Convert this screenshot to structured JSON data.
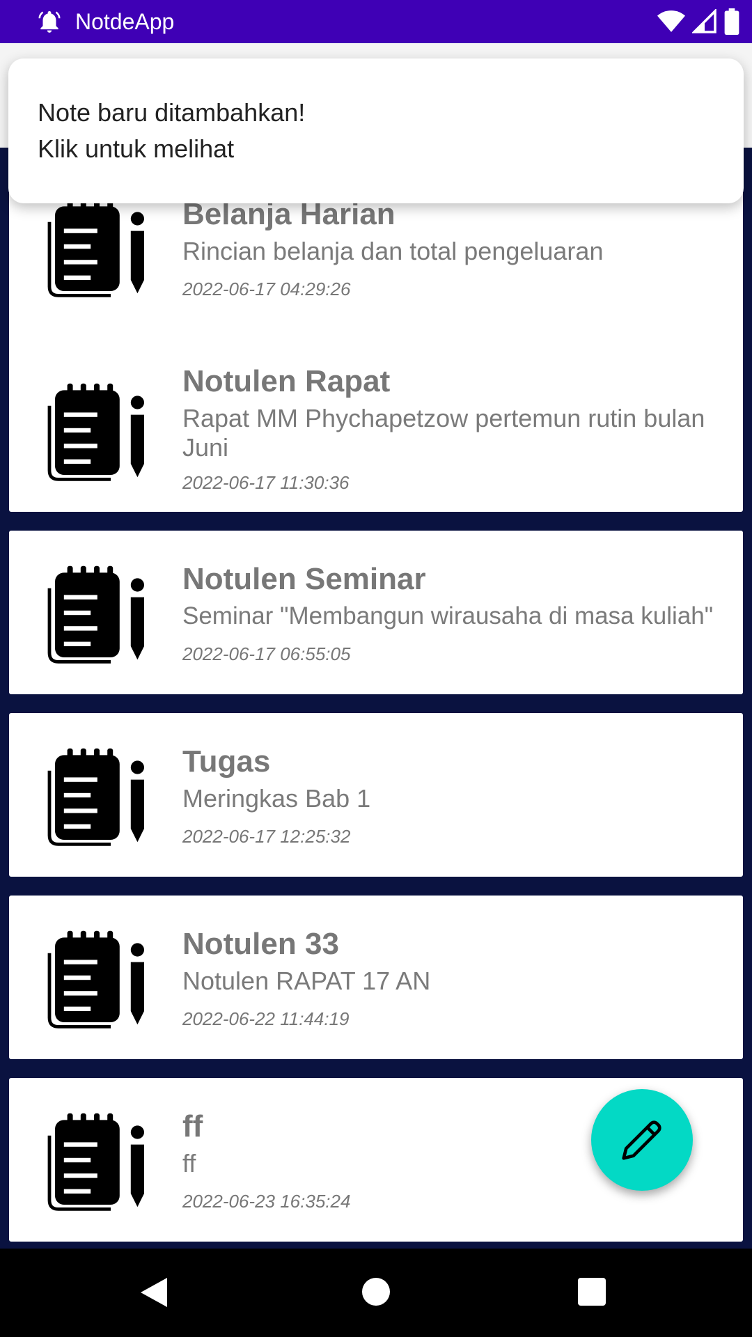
{
  "status_bar": {
    "app_name": "NotdeApp",
    "icons": [
      "notification-bell-icon",
      "wifi-icon",
      "cell-signal-icon",
      "battery-icon"
    ]
  },
  "toast": {
    "line1": "Note baru ditambahkan!",
    "line2": "Klik untuk melihat"
  },
  "notes": [
    {
      "title": "Belanja Harian",
      "desc": "Rincian belanja dan total pengeluaran",
      "date": "2022-06-17 04:29:26"
    },
    {
      "title": "Notulen Rapat",
      "desc": "Rapat MM Phychapetzow pertemun rutin bulan Juni",
      "date": "2022-06-17 11:30:36"
    },
    {
      "title": "Notulen Seminar",
      "desc": "Seminar \"Membangun wirausaha di masa kuliah\"",
      "date": "2022-06-17 06:55:05"
    },
    {
      "title": "Tugas",
      "desc": "Meringkas Bab 1",
      "date": "2022-06-17 12:25:32"
    },
    {
      "title": "Notulen 33",
      "desc": "Notulen RAPAT 17 AN",
      "date": "2022-06-22 11:44:19"
    },
    {
      "title": "ff",
      "desc": "ff",
      "date": "2022-06-23 16:35:24"
    }
  ],
  "fab": {
    "icon": "pencil-icon",
    "color": "#03d9c5"
  },
  "nav": {
    "icons": [
      "back-icon",
      "home-icon",
      "recents-icon"
    ]
  },
  "colors": {
    "status_bar": "#3f00b5",
    "list_background": "#0a1240",
    "card": "#ffffff"
  }
}
